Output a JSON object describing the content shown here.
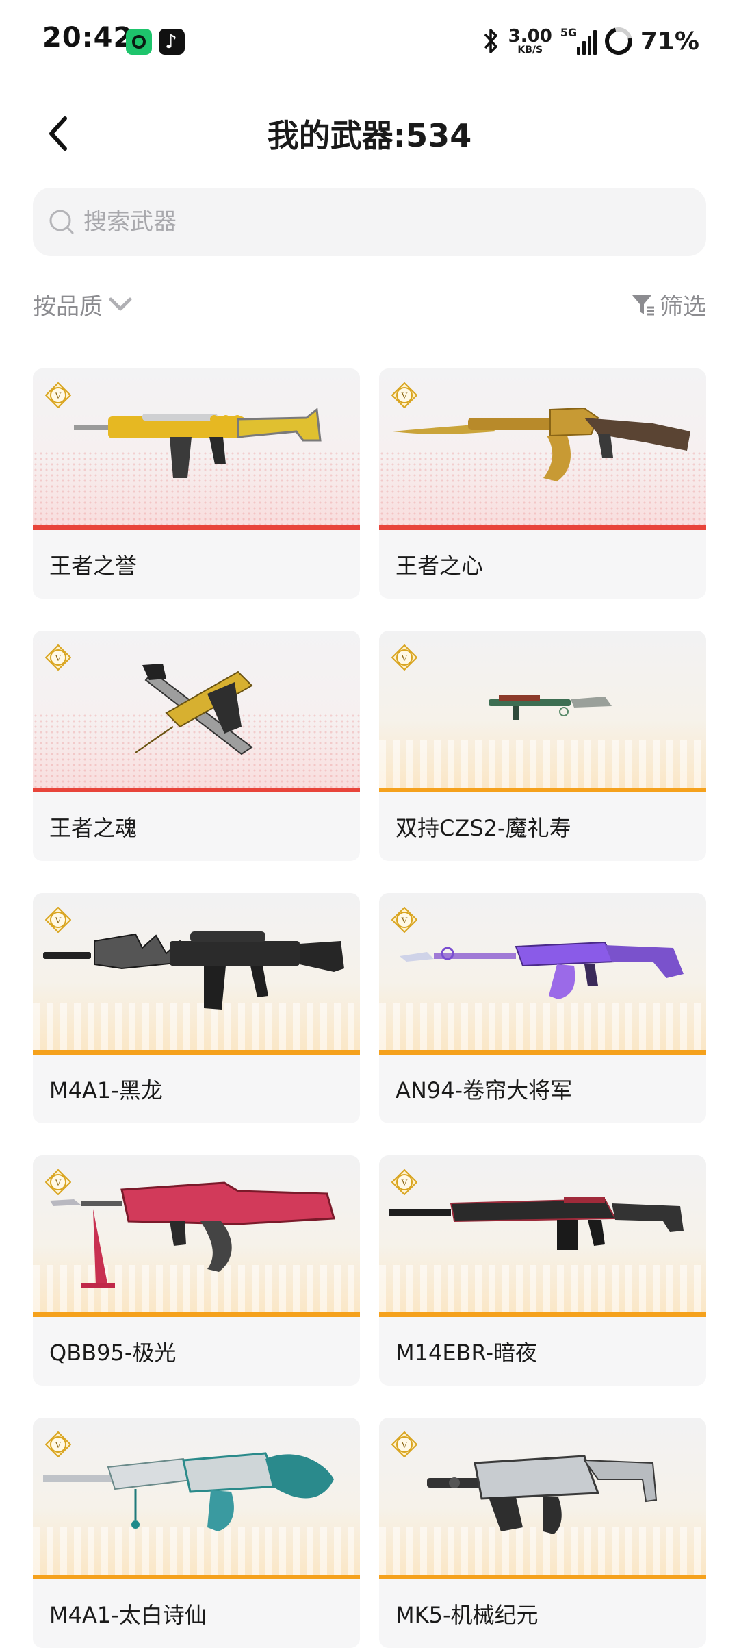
{
  "status_bar": {
    "time": "20:42",
    "app_icons": [
      "video-app-icon",
      "tiktok-icon"
    ],
    "bluetooth_icon": "bluetooth-icon",
    "net_speed_value": "3.00",
    "net_speed_unit": "KB/S",
    "network_label": "5G",
    "battery_percent": "71%"
  },
  "header": {
    "back_icon": "chevron-left-icon",
    "title": "我的武器:534"
  },
  "search": {
    "placeholder": "搜索武器",
    "value": "",
    "icon": "search-icon"
  },
  "filters": {
    "sort_label": "按品质",
    "sort_icon": "chevron-down-icon",
    "filter_label": "筛选",
    "filter_icon": "funnel-icon"
  },
  "colors": {
    "red_quality": "#e8443a",
    "gold_quality": "#f5a11c",
    "badge_gold": "#d9a521"
  },
  "weapons": [
    {
      "name": "王者之誉",
      "quality": "red",
      "badge": "V",
      "image": "gold-assault-rifle"
    },
    {
      "name": "王者之心",
      "quality": "red",
      "badge": "V",
      "image": "gold-ak-rifle"
    },
    {
      "name": "王者之魂",
      "quality": "red",
      "badge": "V",
      "image": "gold-dual-pistol"
    },
    {
      "name": "双持CZS2-魔礼寿",
      "quality": "gold",
      "badge": "V",
      "image": "green-smg"
    },
    {
      "name": "M4A1-黑龙",
      "quality": "gold",
      "badge": "V",
      "image": "black-m4a1"
    },
    {
      "name": "AN94-卷帘大将军",
      "quality": "gold",
      "badge": "V",
      "image": "purple-an94"
    },
    {
      "name": "QBB95-极光",
      "quality": "gold",
      "badge": "V",
      "image": "red-qbb95"
    },
    {
      "name": "M14EBR-暗夜",
      "quality": "gold",
      "badge": "V",
      "image": "black-m14ebr"
    },
    {
      "name": "M4A1-太白诗仙",
      "quality": "gold",
      "badge": "V",
      "image": "silver-teal-m4a1"
    },
    {
      "name": "MK5-机械纪元",
      "quality": "gold",
      "badge": "V",
      "image": "silver-mk5"
    }
  ]
}
